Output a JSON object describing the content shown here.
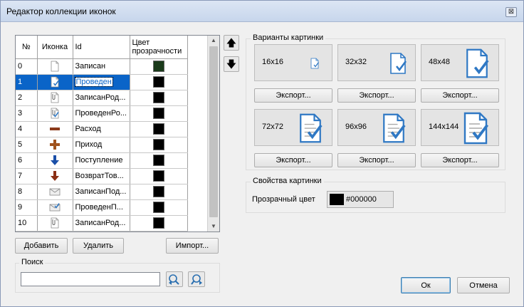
{
  "window": {
    "title": "Редактор коллекции иконок",
    "close_glyph": "⊠"
  },
  "table": {
    "headers": {
      "num": "№",
      "icon": "Иконка",
      "id": "Id",
      "color": "Цвет прозрачности"
    },
    "rows": [
      {
        "num": "0",
        "icon": "doc-icon",
        "id": "Записан",
        "color": "#1a3a1a"
      },
      {
        "num": "1",
        "icon": "doc-check-icon",
        "id": "Проведен",
        "color": "#000000"
      },
      {
        "num": "2",
        "icon": "doc-clip-icon",
        "id": "ЗаписанРод...",
        "color": "#000000"
      },
      {
        "num": "3",
        "icon": "doc-clip-check-icon",
        "id": "ПроведенРо...",
        "color": "#000000"
      },
      {
        "num": "4",
        "icon": "minus-icon",
        "id": "Расход",
        "color": "#000000"
      },
      {
        "num": "5",
        "icon": "plus-icon",
        "id": "Приход",
        "color": "#000000"
      },
      {
        "num": "6",
        "icon": "arrow-down-blue-icon",
        "id": "Поступление",
        "color": "#000000"
      },
      {
        "num": "7",
        "icon": "arrow-down-brown-icon",
        "id": "ВозвратТов...",
        "color": "#000000"
      },
      {
        "num": "8",
        "icon": "envelope-icon",
        "id": "ЗаписанПод...",
        "color": "#000000"
      },
      {
        "num": "9",
        "icon": "envelope-check-icon",
        "id": "ПроведенП...",
        "color": "#000000"
      },
      {
        "num": "10",
        "icon": "doc-clip-icon",
        "id": "ЗаписанРод...",
        "color": "#000000"
      }
    ],
    "selected_index": 1
  },
  "buttons": {
    "add": "Добавить",
    "delete": "Удалить",
    "import": "Импорт...",
    "ok": "Ок",
    "cancel": "Отмена",
    "move_up": "🡅",
    "move_down": "🡇"
  },
  "search": {
    "label": "Поиск",
    "value": ""
  },
  "variants": {
    "label": "Варианты картинки",
    "export_label": "Экспорт...",
    "tiles": [
      "16x16",
      "32x32",
      "48x48",
      "72x72",
      "96x96",
      "144x144"
    ]
  },
  "properties": {
    "label": "Свойства картинки",
    "transparent_label": "Прозрачный цвет",
    "transparent_value": "#000000",
    "transparent_color": "#000000"
  },
  "accent_colors": {
    "selection": "#0a64c8",
    "check": "#2f78c4"
  }
}
